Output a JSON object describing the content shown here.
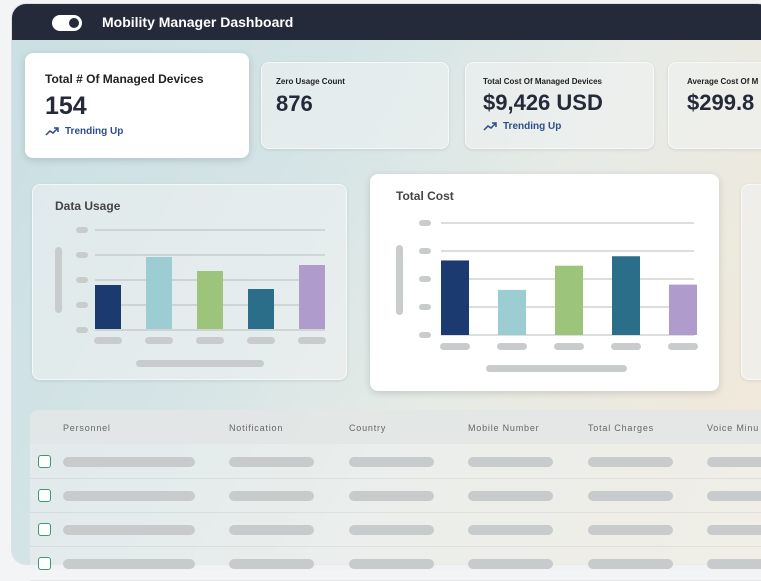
{
  "app": {
    "title": "Mobility Manager Dashboard"
  },
  "kpis": [
    {
      "label": "Total # Of Managed Devices",
      "value": "154",
      "trend": "Trending Up"
    },
    {
      "label": "Zero Usage Count",
      "value": "876"
    },
    {
      "label": "Total Cost Of Managed Devices",
      "value": "$9,426 USD",
      "trend": "Trending Up"
    },
    {
      "label": "Average Cost Of M",
      "value": "$299.8"
    }
  ],
  "charts": [
    {
      "chart_data": {
        "type": "bar",
        "title": "Data Usage",
        "values": [
          44,
          72,
          58,
          40,
          64
        ],
        "ylim": [
          0,
          100
        ],
        "colors": [
          "#1b3a70",
          "#9ccdd3",
          "#9cc47a",
          "#2a6e8a",
          "#b09ccc"
        ]
      }
    },
    {
      "chart_data": {
        "type": "bar",
        "title": "Total Cost",
        "values": [
          71,
          43,
          66,
          75,
          48
        ],
        "ylim": [
          0,
          100
        ],
        "colors": [
          "#1b3a70",
          "#9ccdd3",
          "#9cc47a",
          "#2a6e8a",
          "#b09ccc"
        ]
      }
    }
  ],
  "table": {
    "columns": [
      "Personnel",
      "Notification",
      "Country",
      "Mobile Number",
      "Total Charges",
      "Voice Minu"
    ]
  },
  "colors": {
    "header": "#252a3a",
    "trend": "#2c4e8a",
    "checkbox": "#3a9a6e"
  }
}
